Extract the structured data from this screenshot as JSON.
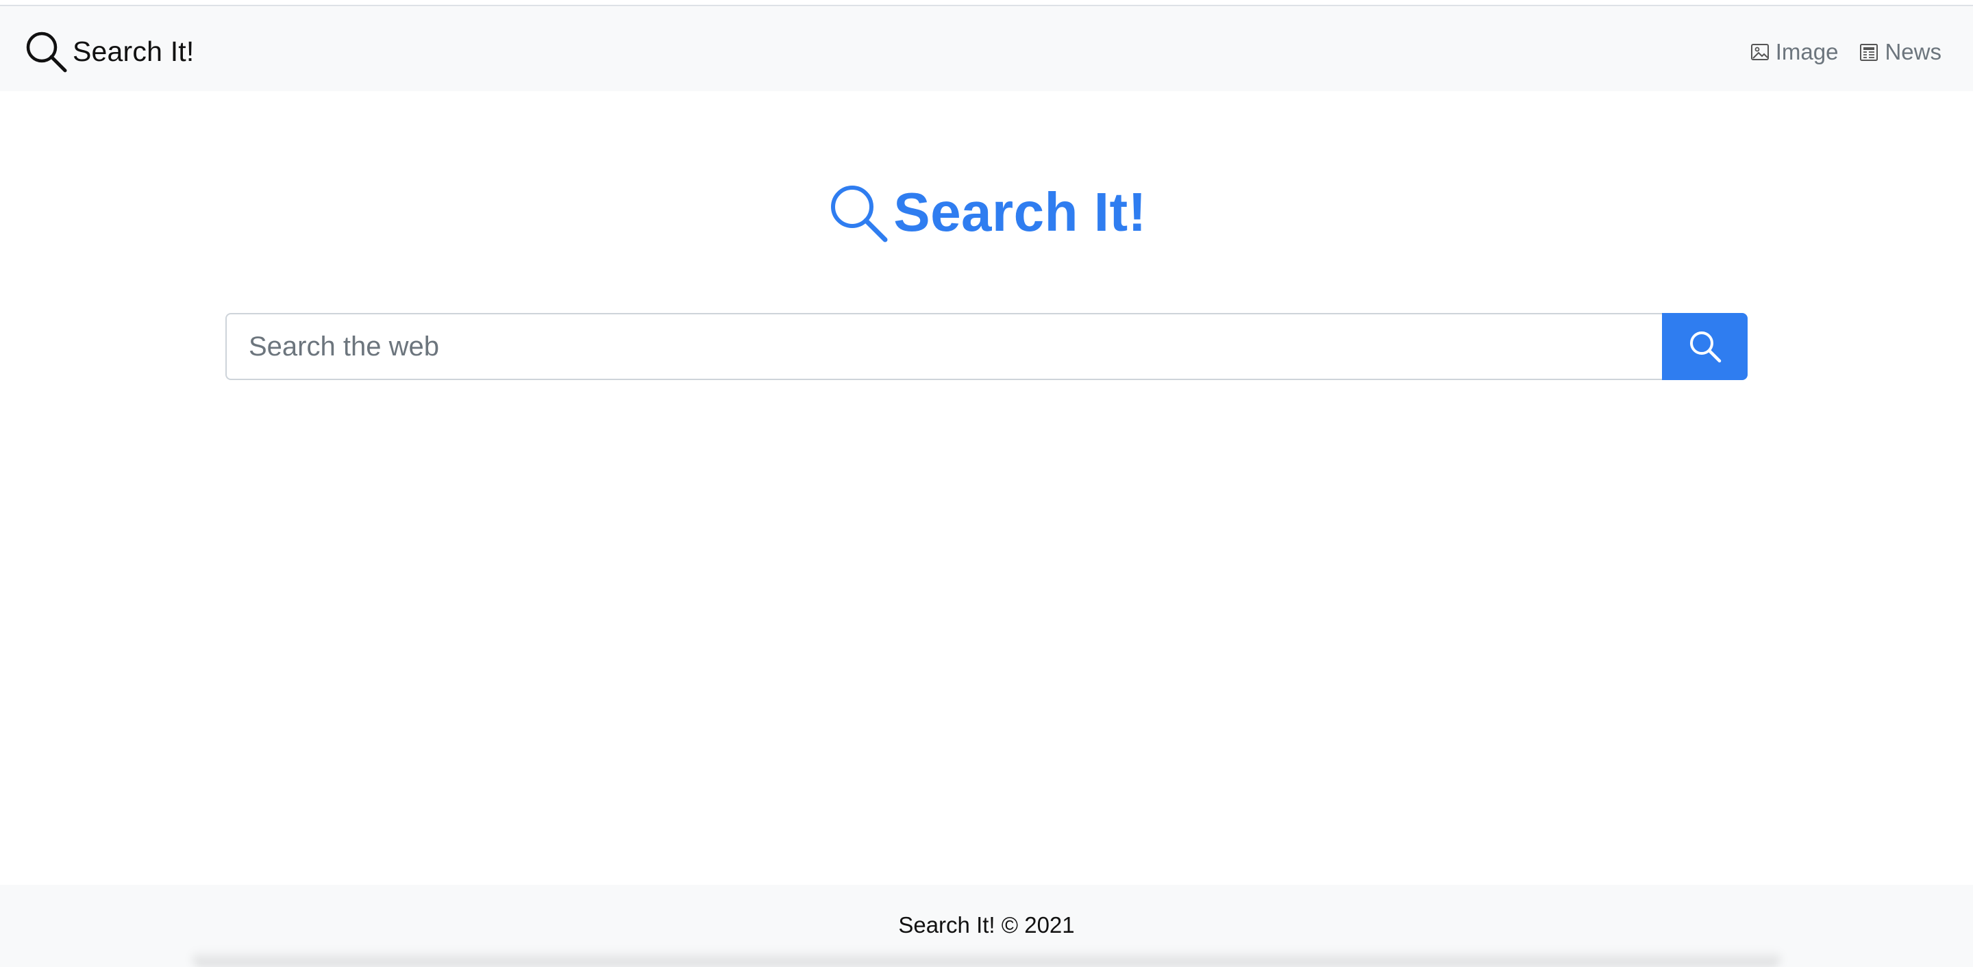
{
  "navbar": {
    "brand_icon": "search-icon",
    "brand_text": "Search It!",
    "links": [
      {
        "icon": "image-icon",
        "label": "Image"
      },
      {
        "icon": "newspaper-icon",
        "label": "News"
      }
    ]
  },
  "hero": {
    "icon": "search-icon",
    "title": "Search It!"
  },
  "search": {
    "placeholder": "Search the web",
    "value": "",
    "button_icon": "search-icon"
  },
  "footer": {
    "text": "Search It! © 2021"
  },
  "colors": {
    "accent": "#2f7df0",
    "navbar_bg": "#f8f9fa",
    "muted_text": "#6c757d"
  }
}
